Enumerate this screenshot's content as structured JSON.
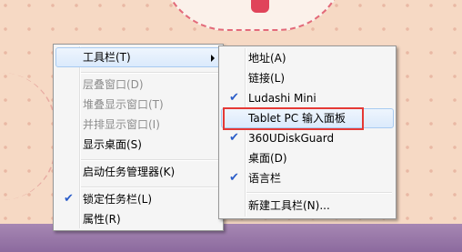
{
  "context_menu": {
    "items": [
      {
        "label": "工具栏(T)",
        "enabled": true,
        "submenu": true
      },
      {
        "label": "层叠窗口(D)",
        "enabled": false
      },
      {
        "label": "堆叠显示窗口(T)",
        "enabled": false
      },
      {
        "label": "并排显示窗口(I)",
        "enabled": false
      },
      {
        "label": "显示桌面(S)",
        "enabled": true
      },
      {
        "label": "启动任务管理器(K)",
        "enabled": true
      },
      {
        "label": "锁定任务栏(L)",
        "enabled": true,
        "checked": true
      },
      {
        "label": "属性(R)",
        "enabled": true
      }
    ]
  },
  "toolbars_submenu": {
    "items": [
      {
        "label": "地址(A)",
        "checked": false
      },
      {
        "label": "链接(L)",
        "checked": false
      },
      {
        "label": "Ludashi Mini",
        "checked": true
      },
      {
        "label": "Tablet PC 输入面板",
        "checked": false,
        "highlighted": true
      },
      {
        "label": "360UDiskGuard",
        "checked": true
      },
      {
        "label": "桌面(D)",
        "checked": false
      },
      {
        "label": "语言栏",
        "checked": true
      },
      {
        "label": "新建工具栏(N)...",
        "checked": false
      }
    ]
  },
  "colors": {
    "highlight_box": "#e53935",
    "check_mark": "#2c5ec9",
    "taskbar": "#9a78ab"
  }
}
